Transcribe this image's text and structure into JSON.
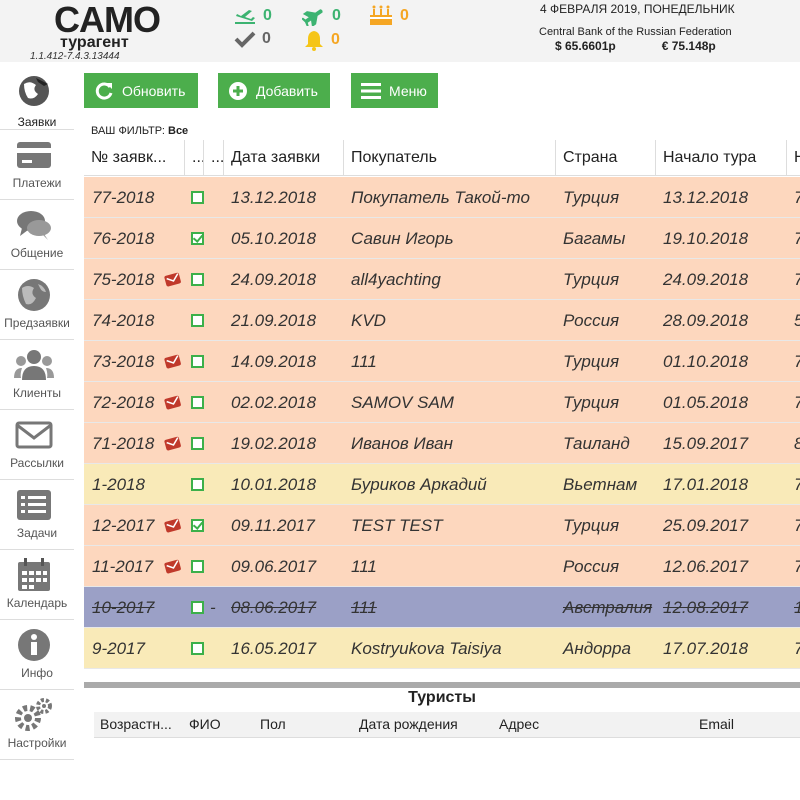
{
  "header": {
    "logo_main": "CAMO",
    "logo_sub": "турагент",
    "version": "1.1.412-7.4.3.13444",
    "counters": {
      "departures": "0",
      "returns": "0",
      "birthdays": "0",
      "done": "0",
      "alerts": "0"
    },
    "date": "4 ФЕВРАЛЯ 2019, ПОНЕДЕЛЬНИК",
    "bank": "Central Bank of the Russian Federation",
    "usd_rate": "$ 65.6601р",
    "eur_rate": "€ 75.148р"
  },
  "colors": {
    "accent_green": "#4cae4c",
    "row_peach": "#fdd7be",
    "row_yellow": "#f9eab8",
    "row_cancelled": "#9ba0c6"
  },
  "sidebar": {
    "items": [
      {
        "label": "Заявки",
        "icon": "globe-plane-icon"
      },
      {
        "label": "Платежи",
        "icon": "credit-card-icon"
      },
      {
        "label": "Общение",
        "icon": "chat-bubbles-icon"
      },
      {
        "label": "Предзаявки",
        "icon": "globe-icon"
      },
      {
        "label": "Клиенты",
        "icon": "users-icon"
      },
      {
        "label": "Рассылки",
        "icon": "envelope-icon"
      },
      {
        "label": "Задачи",
        "icon": "task-list-icon"
      },
      {
        "label": "Календарь",
        "icon": "calendar-icon"
      },
      {
        "label": "Инфо",
        "icon": "info-icon"
      },
      {
        "label": "Настройки",
        "icon": "gears-icon"
      }
    ]
  },
  "toolbar": {
    "refresh_label": "Обновить",
    "add_label": "Добавить",
    "menu_label": "Меню"
  },
  "filter": {
    "prefix": "ВАШ ФИЛЬТР:",
    "value": "Все"
  },
  "grid": {
    "columns": [
      "№ заявк...",
      "...",
      "...",
      "Дата заявки",
      "Покупатель",
      "Страна",
      "Начало тура",
      "Н"
    ],
    "rows": [
      {
        "num": "77-2018",
        "msg": false,
        "checked": false,
        "dash": "",
        "date": "13.12.2018",
        "buyer": "Покупатель Такой-то",
        "country": "Турция",
        "start": "13.12.2018",
        "extra": "7",
        "style": "peach"
      },
      {
        "num": "76-2018",
        "msg": false,
        "checked": true,
        "dash": "",
        "date": "05.10.2018",
        "buyer": "Савин Игорь",
        "country": "Багамы",
        "start": "19.10.2018",
        "extra": "7",
        "style": "peach"
      },
      {
        "num": "75-2018",
        "msg": true,
        "checked": false,
        "dash": "",
        "date": "24.09.2018",
        "buyer": "all4yachting",
        "country": "Турция",
        "start": "24.09.2018",
        "extra": "7",
        "style": "peach"
      },
      {
        "num": "74-2018",
        "msg": false,
        "checked": false,
        "dash": "",
        "date": "21.09.2018",
        "buyer": "KVD",
        "country": "Россия",
        "start": "28.09.2018",
        "extra": "5",
        "style": "peach"
      },
      {
        "num": "73-2018",
        "msg": true,
        "checked": false,
        "dash": "",
        "date": "14.09.2018",
        "buyer": "111",
        "country": "Турция",
        "start": "01.10.2018",
        "extra": "7",
        "style": "peach"
      },
      {
        "num": "72-2018",
        "msg": true,
        "checked": false,
        "dash": "",
        "date": "02.02.2018",
        "buyer": "SAMOV SAM",
        "country": "Турция",
        "start": "01.05.2018",
        "extra": "7",
        "style": "peach"
      },
      {
        "num": "71-2018",
        "msg": true,
        "checked": false,
        "dash": "",
        "date": "19.02.2018",
        "buyer": "Иванов Иван",
        "country": "Таиланд",
        "start": "15.09.2017",
        "extra": "8",
        "style": "peach"
      },
      {
        "num": "1-2018",
        "msg": false,
        "checked": false,
        "dash": "",
        "date": "10.01.2018",
        "buyer": "Буриков Аркадий",
        "country": "Вьетнам",
        "start": "17.01.2018",
        "extra": "7",
        "style": "yellow"
      },
      {
        "num": "12-2017",
        "msg": true,
        "checked": true,
        "dash": "",
        "date": "09.11.2017",
        "buyer": "TEST TEST",
        "country": "Турция",
        "start": "25.09.2017",
        "extra": "7",
        "style": "peach"
      },
      {
        "num": "11-2017",
        "msg": true,
        "checked": false,
        "dash": "",
        "date": "09.06.2017",
        "buyer": "111",
        "country": "Россия",
        "start": "12.06.2017",
        "extra": "7",
        "style": "peach"
      },
      {
        "num": "10-2017",
        "msg": false,
        "checked": false,
        "dash": "-",
        "date": "08.06.2017",
        "buyer": "111",
        "country": "Австралия",
        "start": "12.08.2017",
        "extra": "1",
        "style": "blue"
      },
      {
        "num": "9-2017",
        "msg": false,
        "checked": false,
        "dash": "",
        "date": "16.05.2017",
        "buyer": "Kostryukova Taisiya",
        "country": "Андорра",
        "start": "17.07.2018",
        "extra": "7",
        "style": "yellow"
      }
    ]
  },
  "tourists": {
    "title": "Туристы",
    "columns": [
      "Возрастн...",
      "ФИО",
      "Пол",
      "Дата рождения",
      "Адрес",
      "Email"
    ]
  }
}
